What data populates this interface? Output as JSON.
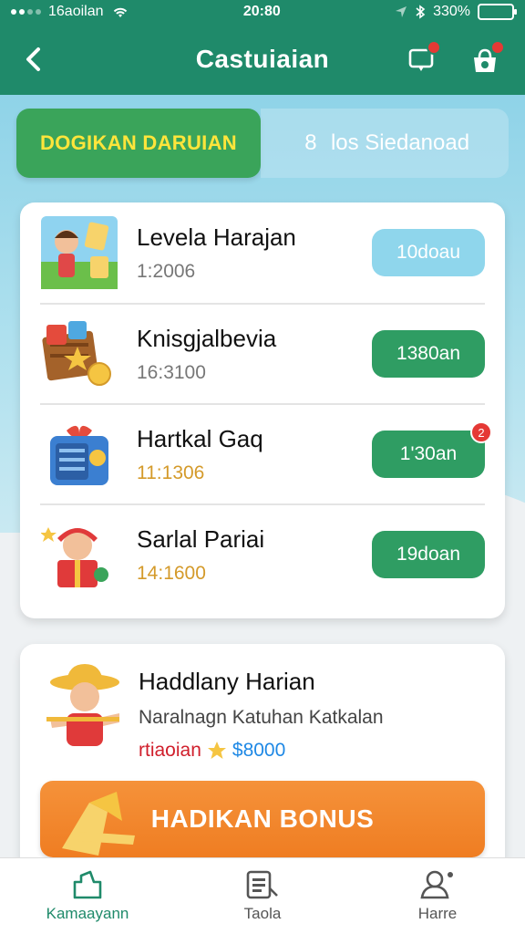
{
  "status_bar": {
    "carrier": "16aoilan",
    "time": "20:80",
    "battery": "330%"
  },
  "header": {
    "title": "Castuiaian"
  },
  "tabs": [
    {
      "label": "DOGIKAN DARUIAN",
      "active": true
    },
    {
      "label": "los Siedanoad",
      "icon": "8",
      "active": false
    }
  ],
  "tasks": [
    {
      "name": "Levela Harajan",
      "sub": "1:2006",
      "button": "10doau",
      "button_style": "light",
      "icon": "kid-with-cards-icon"
    },
    {
      "name": "Knisgjalbevia",
      "sub": "16:3100",
      "button": "1380an",
      "button_style": "green",
      "icon": "treasure-board-icon"
    },
    {
      "name": "Hartkal Gaq",
      "sub": "11:1306",
      "button": "1'30an",
      "button_style": "green",
      "badge": "2",
      "icon": "gift-box-icon"
    },
    {
      "name": "Sarlal Pariai",
      "sub": "14:1600",
      "button": "19doan",
      "button_style": "green",
      "icon": "kid-with-gift-icon"
    }
  ],
  "daily": {
    "title": "Haddlany Harian",
    "subtitle": "Naralnagn Katuhan Katkalan",
    "reward_label": "rtiaoian",
    "reward_value": "$8000",
    "button": "HADIKAN BONUS"
  },
  "nav": [
    {
      "label": "Kamaayann",
      "icon": "home-icon",
      "active": true
    },
    {
      "label": "Taola",
      "icon": "list-icon",
      "active": false
    },
    {
      "label": "Harre",
      "icon": "profile-icon",
      "active": false
    }
  ],
  "colors": {
    "primary": "#1f8a6a",
    "tab_active": "#3aa45a",
    "tab_text": "#ffe53b",
    "bonus": "#ef7d22",
    "badge": "#e53935"
  }
}
